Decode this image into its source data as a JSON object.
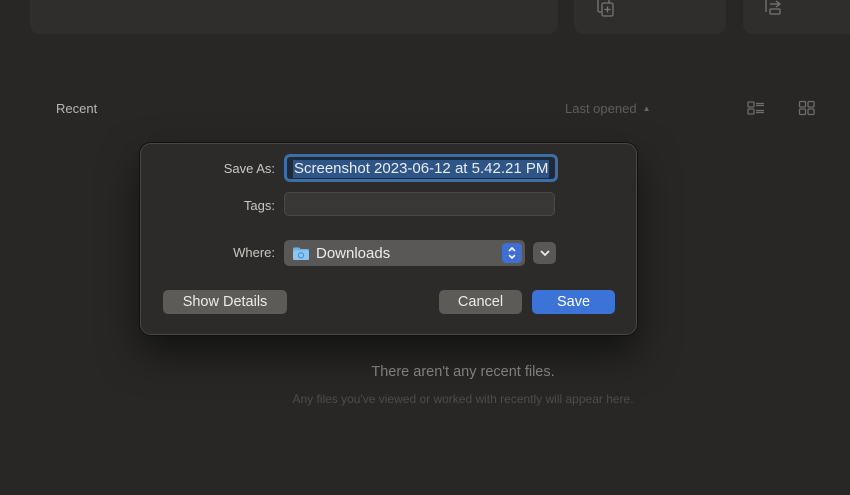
{
  "recent": {
    "label": "Recent",
    "sort_label": "Last opened",
    "sort_caret": "▲"
  },
  "empty_state": {
    "title": "There aren't any recent files.",
    "subtitle": "Any files you've viewed or worked with recently will appear here."
  },
  "dialog": {
    "save_as_label": "Save As:",
    "save_as_value": "Screenshot 2023-06-12 at 5.42.21 PM",
    "tags_label": "Tags:",
    "tags_value": "",
    "where_label": "Where:",
    "where_value": "Downloads",
    "show_details_label": "Show Details",
    "cancel_label": "Cancel",
    "save_label": "Save"
  },
  "colors": {
    "background": "#282726",
    "dialog": "#2d2b29",
    "accent": "#3b73d6",
    "focus_ring": "#3c6ea8"
  },
  "icons": [
    "document-icon",
    "add-file-icon",
    "import-icon",
    "list-view-icon",
    "grid-view-icon",
    "folder-icon",
    "chevron-updown-icon",
    "chevron-down-icon"
  ]
}
